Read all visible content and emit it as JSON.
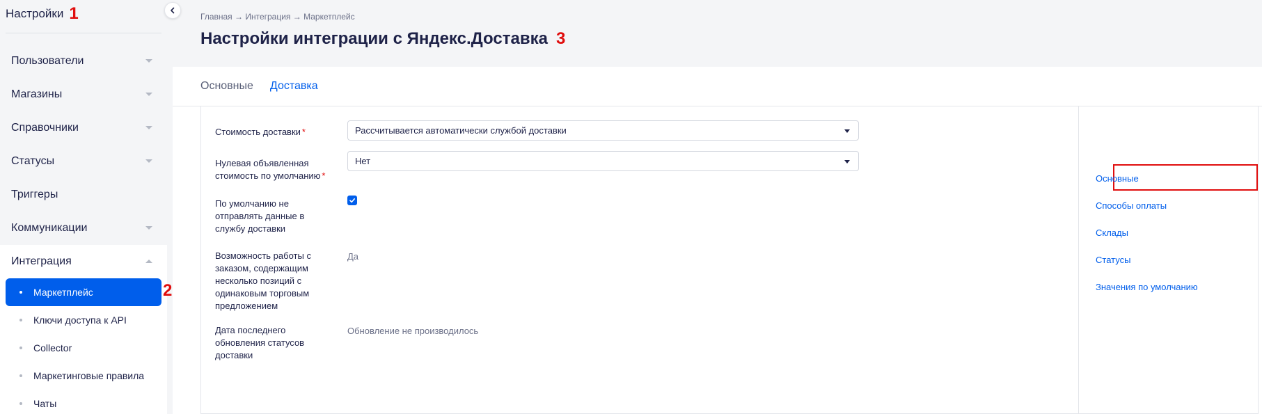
{
  "sidebar": {
    "title": "Настройки",
    "title_annotation": "1",
    "items": [
      {
        "label": "Пользователи",
        "expanded": false
      },
      {
        "label": "Магазины",
        "expanded": false
      },
      {
        "label": "Справочники",
        "expanded": false
      },
      {
        "label": "Статусы",
        "expanded": false
      },
      {
        "label": "Триггеры"
      },
      {
        "label": "Коммуникации",
        "expanded": false
      },
      {
        "label": "Интеграция",
        "expanded": true
      }
    ],
    "sub_items": [
      {
        "label": "Маркетплейс",
        "active": true
      },
      {
        "label": "Ключи доступа к API"
      },
      {
        "label": "Collector"
      },
      {
        "label": "Маркетинговые правила"
      },
      {
        "label": "Чаты"
      }
    ],
    "sub_annotation": "2",
    "collapse_icon": "chevron-left-icon"
  },
  "header": {
    "breadcrumb": "Главная → Интеграция → Маркетплейс",
    "title": "Настройки интеграции с Яндекс.Доставка",
    "title_annotation": "3"
  },
  "tabs": [
    {
      "label": "Основные",
      "active": false
    },
    {
      "label": "Доставка",
      "active": true
    }
  ],
  "form": {
    "delivery_cost": {
      "label": "Стоимость доставки",
      "required": "*",
      "value": "Рассчитывается автоматически службой доставки"
    },
    "zero_declared": {
      "label": "Нулевая объявленная стоимость по умолчанию",
      "required": "*",
      "value": "Нет"
    },
    "no_send": {
      "label": "По умолчанию не отправлять данные в службу доставки",
      "checked": true
    },
    "multi_items": {
      "label": "Возможность работы с заказом, содержащим несколько позиций с одинаковым торговым предложением",
      "value": "Да"
    },
    "last_update": {
      "label": "Дата последнего обновления статусов доставки",
      "value": "Обновление не производилось"
    }
  },
  "side_nav": [
    {
      "label": "Основные",
      "highlighted": true
    },
    {
      "label": "Способы оплаты"
    },
    {
      "label": "Склады"
    },
    {
      "label": "Статусы"
    },
    {
      "label": "Значения по умолчанию"
    }
  ],
  "colors": {
    "accent": "#005eeb",
    "annotation": "#e00d0d",
    "text": "#1e2248"
  }
}
